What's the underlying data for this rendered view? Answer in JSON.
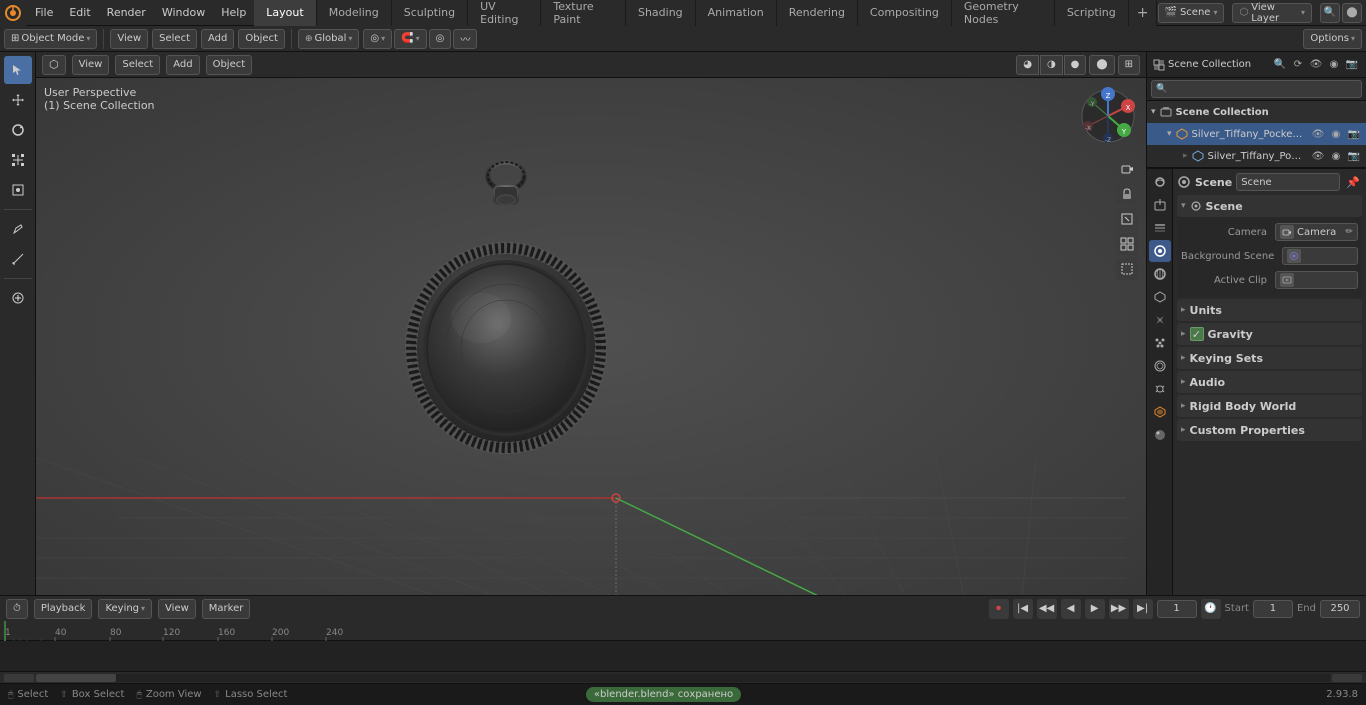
{
  "app": {
    "title": "Blender",
    "version": "2.93.8"
  },
  "menubar": {
    "items": [
      "File",
      "Edit",
      "Render",
      "Window",
      "Help"
    ]
  },
  "workspace_tabs": {
    "tabs": [
      "Layout",
      "Modeling",
      "Sculpting",
      "UV Editing",
      "Texture Paint",
      "Shading",
      "Animation",
      "Rendering",
      "Compositing",
      "Geometry Nodes",
      "Scripting"
    ],
    "active": "Layout",
    "add_label": "+"
  },
  "scene_selector": {
    "label": "Scene",
    "view_layer": "View Layer"
  },
  "toolbar": {
    "mode_label": "Object Mode",
    "view_label": "View",
    "select_label": "Select",
    "add_label": "Add",
    "object_label": "Object",
    "transform_label": "Global",
    "options_label": "Options"
  },
  "viewport": {
    "label_line1": "User Perspective",
    "label_line2": "(1) Scene Collection",
    "nav_axes": [
      "X",
      "Y",
      "Z",
      "-X",
      "-Y",
      "-Z"
    ]
  },
  "outliner": {
    "title": "Scene Collection",
    "filter_placeholder": "",
    "items": [
      {
        "label": "Silver_Tiffany_Pocket_Watch...",
        "indent": 0,
        "expanded": true,
        "icon": "mesh"
      },
      {
        "label": "Silver_Tiffany_Pocket_Wi...",
        "indent": 1,
        "expanded": false,
        "icon": "mesh"
      }
    ]
  },
  "properties": {
    "active_tab": "scene",
    "tabs": [
      "render",
      "output",
      "view-layer",
      "scene",
      "world",
      "object",
      "modifier",
      "particles",
      "physics",
      "constraints",
      "object-data",
      "material",
      "shadertree"
    ],
    "scene_label": "Scene",
    "scene_name": "Scene",
    "sections": {
      "scene": {
        "title": "Scene",
        "camera_label": "Camera",
        "camera_value": "Camera",
        "background_scene_label": "Background Scene",
        "background_scene_value": "",
        "active_clip_label": "Active Clip",
        "active_clip_value": ""
      },
      "units": {
        "title": "Units",
        "collapsed": true
      },
      "gravity": {
        "title": "Gravity",
        "enabled": true
      },
      "keying_sets": {
        "title": "Keying Sets",
        "collapsed": true
      },
      "audio": {
        "title": "Audio",
        "collapsed": true
      },
      "rigid_body_world": {
        "title": "Rigid Body World",
        "collapsed": true
      },
      "custom_properties": {
        "title": "Custom Properties",
        "collapsed": true
      }
    }
  },
  "timeline": {
    "playback_label": "Playback",
    "keying_label": "Keying",
    "view_label": "View",
    "marker_label": "Marker",
    "current_frame": "1",
    "start_frame": "1",
    "end_frame": "250",
    "start_label": "Start",
    "end_label": "End",
    "ticks": [
      "1",
      "40",
      "80",
      "120",
      "160",
      "200",
      "240"
    ],
    "tick_values": [
      1,
      40,
      80,
      120,
      160,
      200,
      240
    ],
    "markers": []
  },
  "statusbar": {
    "select_label": "Select",
    "box_select_label": "Box Select",
    "zoom_view_label": "Zoom View",
    "lasso_select_label": "Lasso Select",
    "saved_label": "«blender.blend» сохранено"
  },
  "icons": {
    "cursor": "⊕",
    "move": "⤢",
    "rotate": "↺",
    "scale": "⤡",
    "transform": "⊞",
    "annotate": "✏",
    "measure": "📐",
    "add_object": "⊕",
    "arrow": "▶",
    "eye": "👁",
    "camera": "📷",
    "scene": "🎬"
  }
}
